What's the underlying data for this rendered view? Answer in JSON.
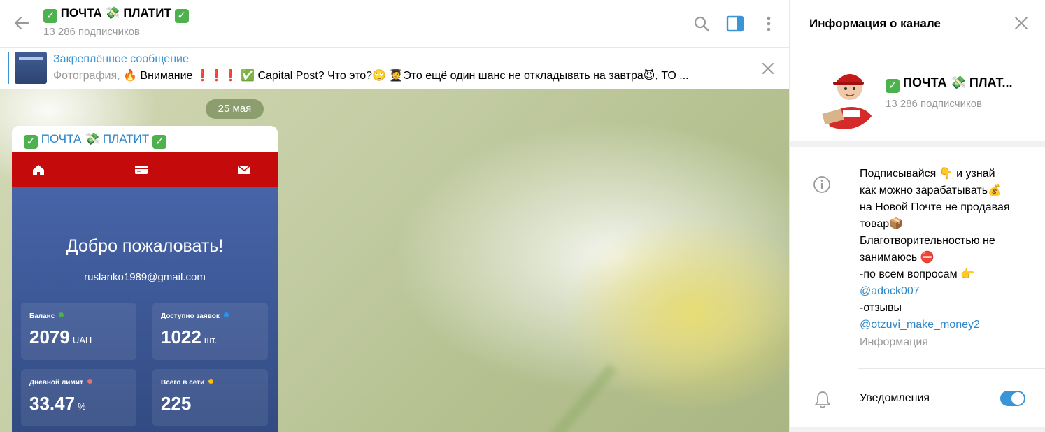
{
  "header": {
    "title": "ПОЧТА 💸 ПЛАТИТ",
    "subscribers": "13 286 подписчиков"
  },
  "pinned": {
    "title": "Закреплённое сообщение",
    "prefix": "Фотография,",
    "text": "🔥 Внимание ❗❗❗ ✅ Capital Post? Что это?🙄 🧑‍🎓Это ещё один шанс не откладывать на завтра😈, ТО ..."
  },
  "chat": {
    "date": "25 мая",
    "message_author": "ПОЧТА 💸 ПЛАТИТ",
    "photo": {
      "welcome": "Добро пожаловать!",
      "email": "ruslanko1989@gmail.com",
      "cards": [
        {
          "label": "Баланс",
          "value": "2079",
          "unit": "UAH",
          "dot": "#4caf50"
        },
        {
          "label": "Доступно заявок",
          "value": "1022",
          "unit": "шт.",
          "dot": "#2196f3"
        },
        {
          "label": "Дневной лимит",
          "value": "33.47",
          "unit": "%",
          "dot": "#e57373"
        },
        {
          "label": "Всего в сети",
          "value": "225",
          "unit": "",
          "dot": "#ffc107"
        }
      ]
    }
  },
  "panel": {
    "title": "Информация о канале",
    "name": "ПОЧТА 💸 ПЛАТ...",
    "subscribers": "13 286 подписчиков",
    "description": [
      {
        "text": "Подписывайся 👇 и узнай",
        "link": false
      },
      {
        "text": "как можно зарабатывать💰",
        "link": false
      },
      {
        "text": "на Новой Почте не продавая",
        "link": false
      },
      {
        "text": "товар📦",
        "link": false
      },
      {
        "text": "Благотворительностью не",
        "link": false
      },
      {
        "text": "занимаюсь ⛔",
        "link": false
      },
      {
        "text": "-по всем вопросам 👉",
        "link": false
      },
      {
        "text": "@adock007",
        "link": true
      },
      {
        "text": "-отзывы",
        "link": false
      },
      {
        "text": "@otzuvi_make_money2",
        "link": true
      }
    ],
    "description_caption": "Информация",
    "notifications_label": "Уведомления",
    "notifications_on": true
  },
  "colors": {
    "accent": "#3a95d6",
    "link": "#2e86c8",
    "nav_red": "#c40a0a"
  }
}
